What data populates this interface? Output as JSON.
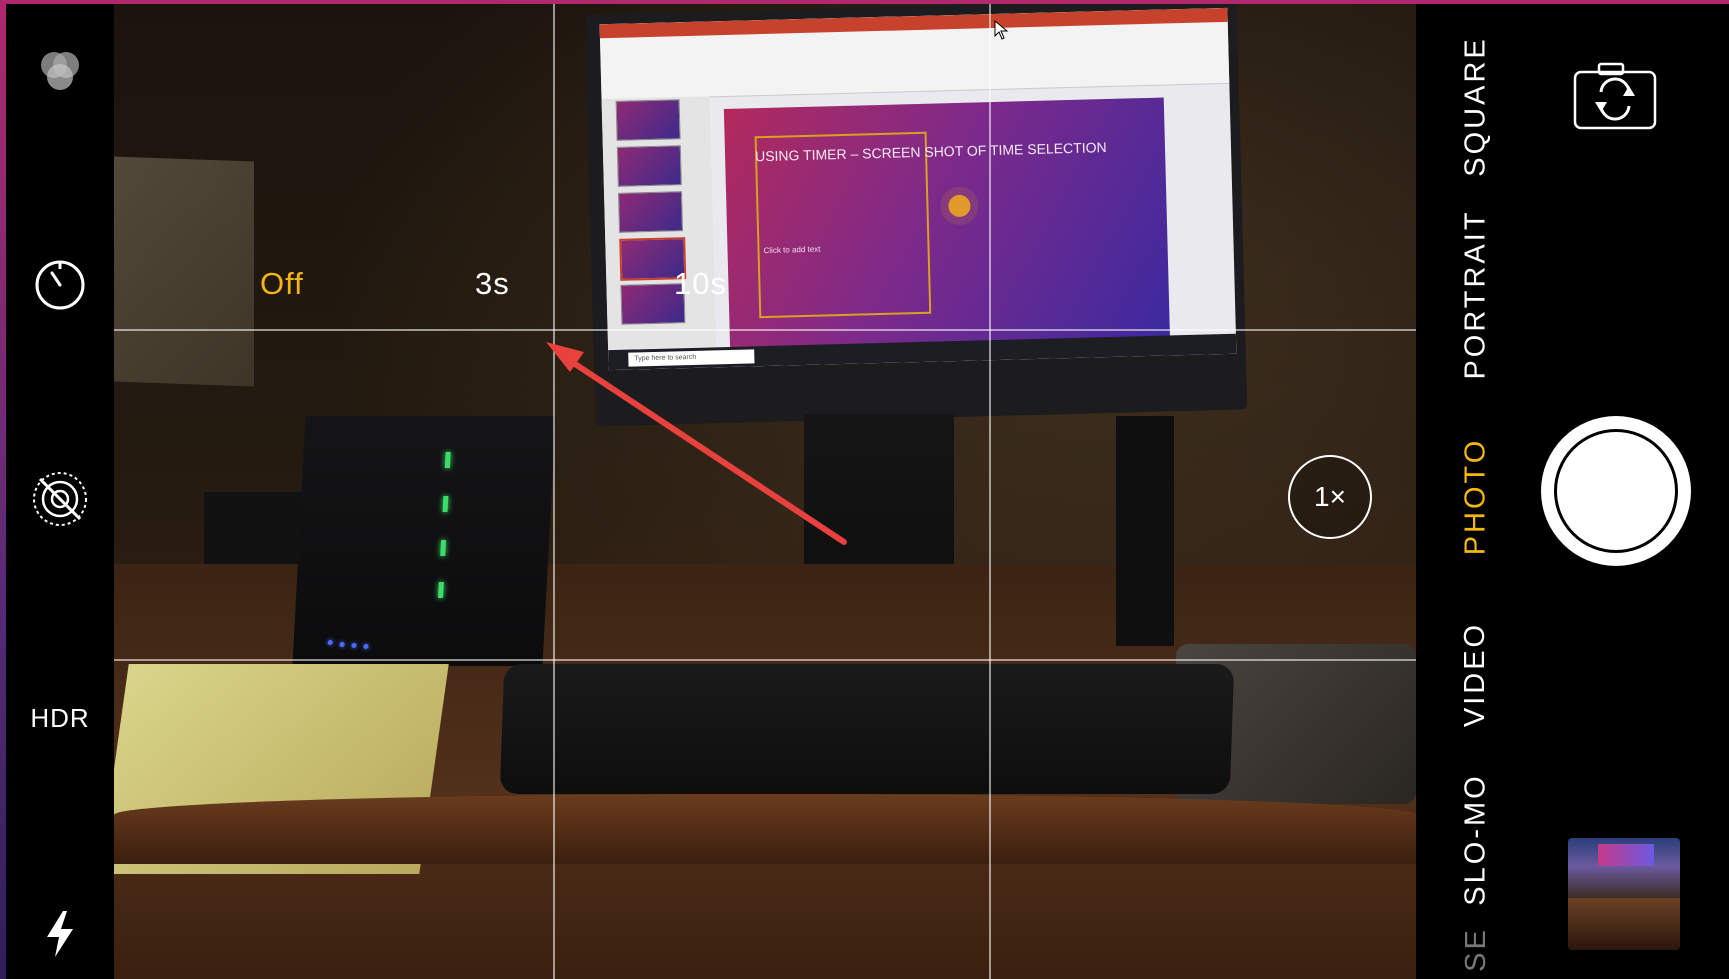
{
  "left_controls": {
    "live_photo_icon": "live-photo-icon",
    "timer_icon": "timer-icon",
    "filter_off_icon": "live-off-icon",
    "hdr_label": "HDR",
    "flash_icon": "flash-icon"
  },
  "timer_menu": {
    "options": [
      "Off",
      "3s",
      "10s"
    ],
    "selected": "Off",
    "selected_color": "#f4b711"
  },
  "viewfinder": {
    "slide_title": "USING TIMER – SCREEN SHOT OF TIME SELECTION",
    "slide_body": "Click to add text",
    "taskbar_search": "Type here to search",
    "zoom_label": "1×"
  },
  "camera_modes": {
    "items": [
      "SQUARE",
      "PORTRAIT",
      "PHOTO",
      "VIDEO",
      "SLO-MO",
      "SE"
    ],
    "active": "PHOTO",
    "active_color": "#f4b711"
  },
  "right_controls": {
    "flip_icon": "flip-camera-icon",
    "shutter_icon": "shutter-button",
    "thumbnail_icon": "last-photo-thumbnail"
  }
}
